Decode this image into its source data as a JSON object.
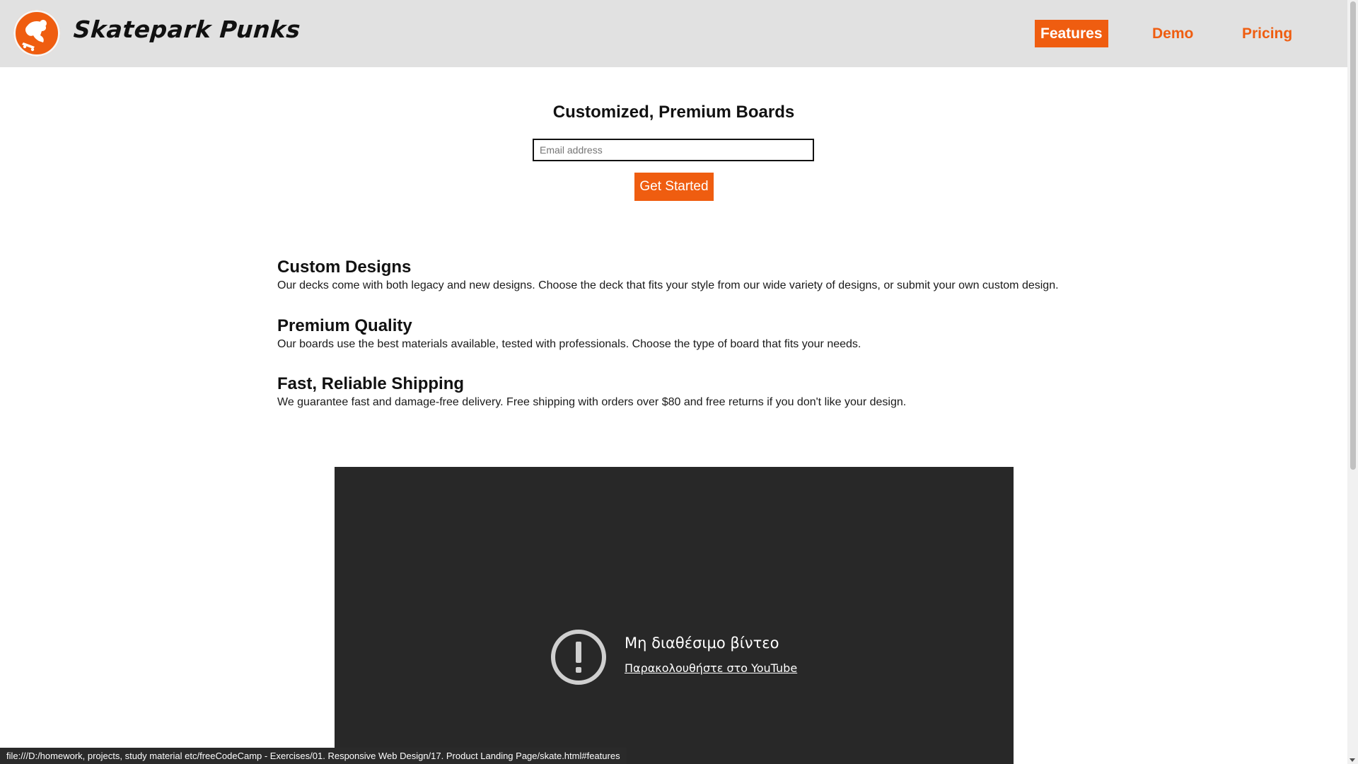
{
  "header": {
    "brand": "Skatepark Punks",
    "nav": [
      {
        "label": "Features",
        "active": true
      },
      {
        "label": "Demo",
        "active": false
      },
      {
        "label": "Pricing",
        "active": false
      }
    ]
  },
  "hero": {
    "title": "Customized, Premium Boards",
    "email_placeholder": "Email address",
    "email_value": "",
    "cta_label": "Get Started"
  },
  "features": [
    {
      "title": "Custom Designs",
      "text": "Our decks come with both legacy and new designs. Choose the deck that fits your style from our wide variety of designs, or submit your own custom design."
    },
    {
      "title": "Premium Quality",
      "text": "Our boards use the best materials available, tested with professionals. Choose the type of board that fits your needs."
    },
    {
      "title": "Fast, Reliable Shipping",
      "text": "We guarantee fast and damage-free delivery. Free shipping with orders over $80 and free returns if you don't like your design."
    }
  ],
  "video": {
    "error_title": "Μη διαθέσιμο βίντεο",
    "error_link": "Παρακολουθήστε στο YouTube",
    "icon": "alert-circle-icon"
  },
  "status_bar": {
    "url": "file:///D:/homework, projects, study material etc/freeCodeCamp - Exercises/01. Responsive Web Design/17. Product Landing Page/skate.html#features"
  },
  "colors": {
    "accent": "#ef5d10",
    "header_bg": "#e1e1e1",
    "video_bg": "#282828"
  }
}
